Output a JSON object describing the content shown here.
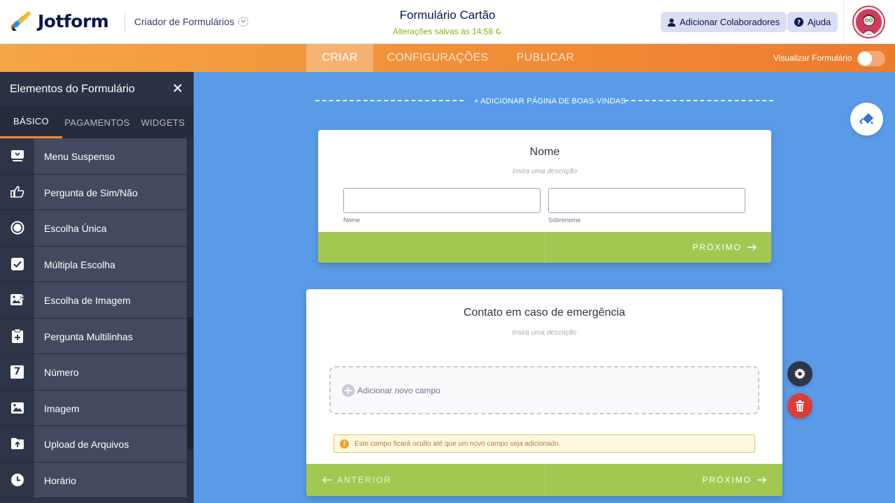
{
  "header": {
    "logo_text": "Jotform",
    "builder_label": "Criador de Formulários",
    "form_title": "Formulário Cartão",
    "saved_status": "Alterações salvas às 14:58",
    "collaborators_label": "Adicionar Colaboradores",
    "help_label": "Ajuda"
  },
  "nav": {
    "tabs": [
      {
        "label": "CRIAR"
      },
      {
        "label": "CONFIGURAÇÕES"
      },
      {
        "label": "PUBLICAR"
      }
    ],
    "preview_label": "Visualizar Formulário",
    "preview_enabled": false
  },
  "sidebar": {
    "title": "Elementos do Formulário",
    "tabs": [
      {
        "label": "BÁSICO"
      },
      {
        "label": "PAGAMENTOS"
      },
      {
        "label": "WIDGETS"
      }
    ],
    "items": [
      {
        "label": "Menu Suspenso",
        "icon": "dropdown-icon"
      },
      {
        "label": "Pergunta de Sim/Não",
        "icon": "thumbs-icon"
      },
      {
        "label": "Escolha Única",
        "icon": "radio-icon"
      },
      {
        "label": "Múltipla Escolha",
        "icon": "checkbox-icon"
      },
      {
        "label": "Escolha de Imagem",
        "icon": "image-choice-icon"
      },
      {
        "label": "Pergunta Multilinhas",
        "icon": "clipboard-icon"
      },
      {
        "label": "Número",
        "icon": "number-icon",
        "glyph": "7"
      },
      {
        "label": "Imagem",
        "icon": "image-icon"
      },
      {
        "label": "Upload de Arquivos",
        "icon": "upload-icon"
      },
      {
        "label": "Horário",
        "icon": "clock-icon"
      }
    ]
  },
  "canvas": {
    "welcome_link": "+ ADICIONAR PÁGINA DE BOAS-VINDAS",
    "card1": {
      "title": "Nome",
      "description_placeholder": "Insira uma descrição",
      "first_label": "Nome",
      "last_label": "Sobrenome",
      "next_label": "PRÓXIMO"
    },
    "card2": {
      "title": "Contato em caso de emergência",
      "description_placeholder": "Insira uma descrição",
      "add_field_label": "Adicionar novo campo",
      "warning_text": "Este campo ficará oculto até que um novo campo seja adicionado.",
      "prev_label": "ANTERIOR",
      "next_label": "PRÓXIMO"
    }
  },
  "colors": {
    "accent_orange": "#f08c36",
    "canvas_blue": "#5a9be8",
    "footer_green": "#a2c852",
    "sidebar_dark": "#2f3549",
    "delete_red": "#dc3d36"
  }
}
